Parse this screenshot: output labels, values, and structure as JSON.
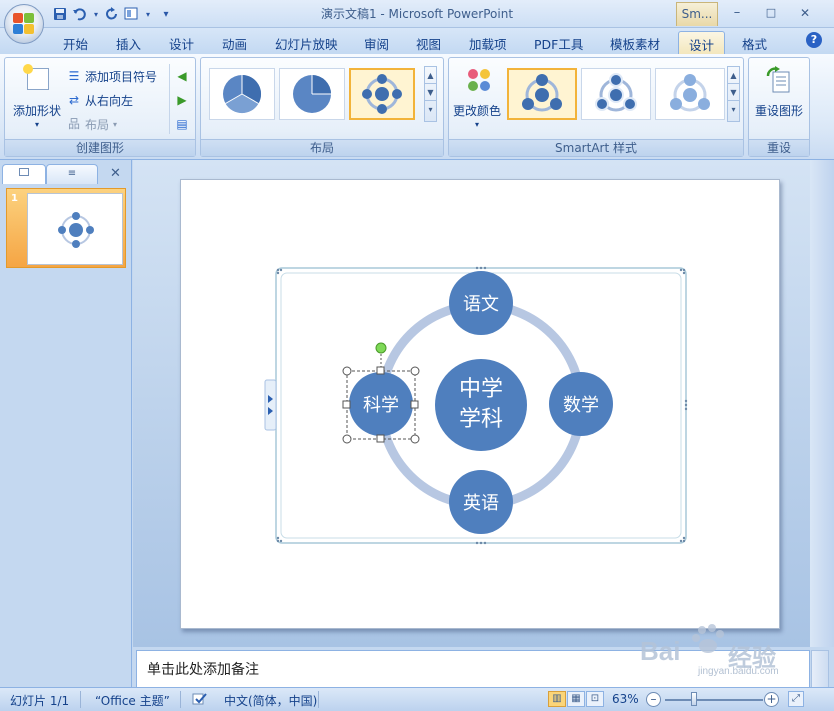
{
  "window": {
    "title": "演示文稿1 - Microsoft PowerPoint",
    "context_tab_label": "Sm...",
    "minimize": "–",
    "maximize": "□",
    "close": "✕"
  },
  "quick_access": {
    "save_icon": "save-icon",
    "undo_icon": "undo-icon",
    "redo_icon": "redo-icon",
    "layout_icon": "layout-icon",
    "customize": "▾"
  },
  "tabs": [
    {
      "label": "开始"
    },
    {
      "label": "插入"
    },
    {
      "label": "设计"
    },
    {
      "label": "动画"
    },
    {
      "label": "幻灯片放映"
    },
    {
      "label": "审阅"
    },
    {
      "label": "视图"
    },
    {
      "label": "加载项"
    },
    {
      "label": "PDF工具"
    },
    {
      "label": "模板素材"
    },
    {
      "label": "设计",
      "active": true,
      "contextual": true
    },
    {
      "label": "格式"
    }
  ],
  "help_label": "?",
  "ribbon": {
    "create_graphic": {
      "label": "创建图形",
      "add_shape": "添加形状",
      "add_bullet": "添加项目符号",
      "right_to_left": "从右向左",
      "layout": "布局"
    },
    "layouts": {
      "label": "布局"
    },
    "smartart_styles": {
      "label": "SmartArt 样式",
      "change_colors": "更改颜色"
    },
    "reset": {
      "label": "重设",
      "reset_graphic": "重设图形"
    }
  },
  "left_pane": {
    "close": "✕",
    "slide_number": "1"
  },
  "smartart": {
    "center": {
      "line1": "中学",
      "line2": "学科"
    },
    "nodes": {
      "top": "语文",
      "right": "数学",
      "bottom": "英语",
      "left": "科学"
    },
    "colors": {
      "node": "#4f7fbe",
      "ring": "#b7c7e2"
    }
  },
  "notes": {
    "placeholder": "单击此处添加备注"
  },
  "status_bar": {
    "slide_info": "幻灯片 1/1",
    "theme": "“Office 主题”",
    "language": "中文(简体，中国)",
    "zoom": "63%",
    "zoom_level_percent": 63
  },
  "watermark": {
    "brand": "Bai",
    "brand2": "经验",
    "url": "jingyan.baidu.com"
  }
}
